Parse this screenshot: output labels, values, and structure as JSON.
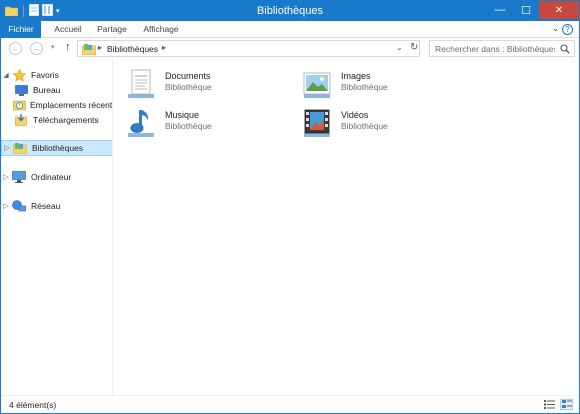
{
  "window": {
    "title": "Bibliothèques"
  },
  "title_controls": {
    "minimize": "—",
    "maximize": "☐",
    "close": "✕"
  },
  "ribbon": {
    "tabs": [
      {
        "label": "Fichier"
      },
      {
        "label": "Accueil"
      },
      {
        "label": "Partage"
      },
      {
        "label": "Affichage"
      }
    ],
    "expand_icon": "chevron-down-icon",
    "help_icon": "help-icon"
  },
  "address": {
    "path_label": "Bibliothèques",
    "search_placeholder": "Rechercher dans : Bibliothèques"
  },
  "nav": {
    "favoris": {
      "label": "Favoris",
      "items": [
        {
          "label": "Bureau"
        },
        {
          "label": "Emplacements récents"
        },
        {
          "label": "Téléchargements"
        }
      ]
    },
    "bibliotheques": "Bibliothèques",
    "ordinateur": "Ordinateur",
    "reseau": "Réseau"
  },
  "libraries": [
    {
      "name": "Documents",
      "type": "Bibliothèque",
      "icon": "documents-library-icon"
    },
    {
      "name": "Images",
      "type": "Bibliothèque",
      "icon": "images-library-icon"
    },
    {
      "name": "Musique",
      "type": "Bibliothèque",
      "icon": "music-library-icon"
    },
    {
      "name": "Vidéos",
      "type": "Bibliothèque",
      "icon": "videos-library-icon"
    }
  ],
  "status": {
    "count_text": "4 élément(s)"
  },
  "colors": {
    "accent": "#1979ca",
    "close": "#c7483e",
    "selection": "#cce8ff",
    "selection_border": "#99d1ff"
  }
}
